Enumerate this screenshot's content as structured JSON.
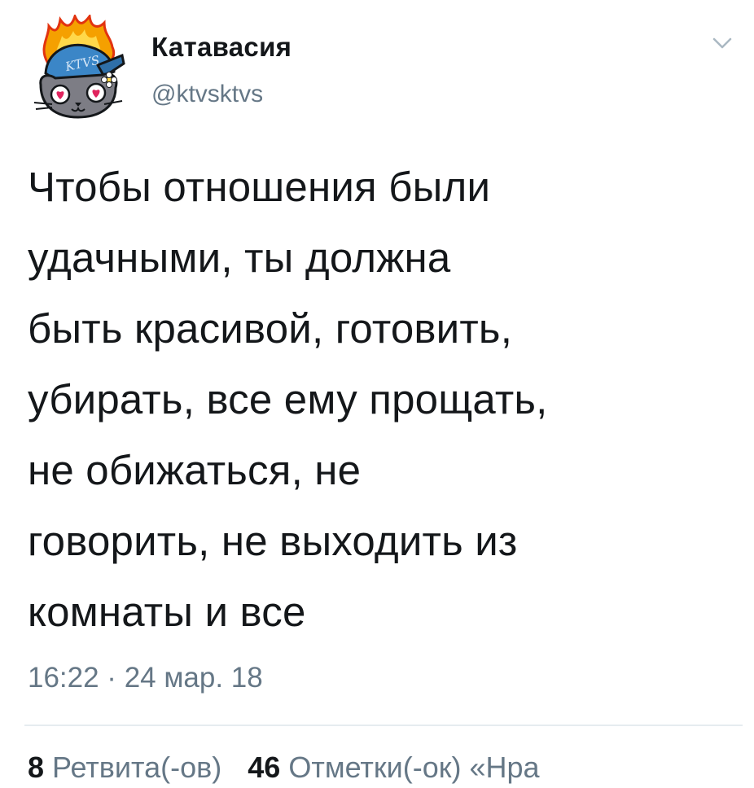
{
  "author": {
    "display_name": "Катавасия",
    "handle": "@ktvsktvs",
    "avatar_label": "KTVS"
  },
  "tweet": {
    "text": "Чтобы отношения были\nудачными, ты должна\nбыть красивой, готовить,\nубирать, все ему прощать,\nне обижаться, не\nговорить, не выходить из\nкомнаты и все",
    "timestamp": "16:22 · 24 мар. 18"
  },
  "stats": {
    "retweets_count": "8",
    "retweets_label": "Ретвита(-ов)",
    "likes_count": "46",
    "likes_label": "Отметки(-ок) «Нра"
  },
  "colors": {
    "text": "#14171a",
    "secondary": "#657786",
    "divider": "#e6ecf0",
    "avatar_cap": "#3b86c7",
    "avatar_flame": "#f5a000",
    "avatar_face": "#7d7d85"
  }
}
